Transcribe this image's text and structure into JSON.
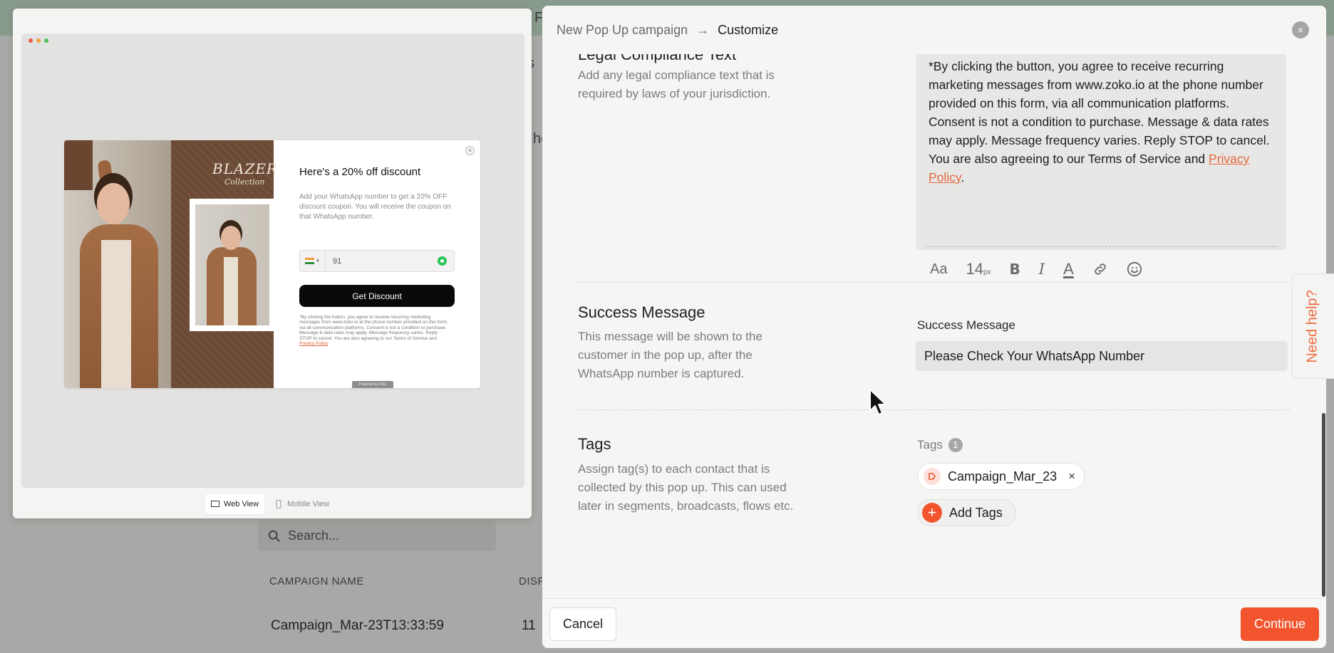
{
  "background": {
    "topbar_letter": "F",
    "partial_s": "s",
    "partial_he": "he",
    "search_placeholder": "Search...",
    "columns": [
      "CAMPAIGN NAME",
      "DISP"
    ],
    "row": {
      "name": "Campaign_Mar-23T13:33:59",
      "value": "11"
    }
  },
  "preview": {
    "popup": {
      "brand_title": "BLAZER",
      "brand_subtitle": "Collection",
      "heading": "Here's a 20% off discount",
      "description": "Add your WhatsApp number to get a 20% OFF discount coupon. You will receive the coupon on that WhatsApp number.",
      "phone_value": "91",
      "cta_label": "Get Discount",
      "legal_text": "*By clicking the button, you agree to receive recurring marketing messages from www.zoko.io at the phone number provided on this form, via all communication platforms. Consent is not a condition to purchase. Message & data rates may apply. Message frequency varies. Reply STOP to cancel. You are also agreeing to our Terms of Service and ",
      "legal_link": "Privacy Policy",
      "legal_end": ".",
      "powered_by": "Powered by Zoko"
    },
    "views": {
      "web": "Web View",
      "mobile": "Mobile View"
    }
  },
  "panel": {
    "breadcrumb": {
      "first": "New Pop Up campaign",
      "arrow": "→",
      "current": "Customize"
    },
    "legal": {
      "title": "Legal Compliance Text",
      "description": "Add any legal compliance text that is required by laws of your jurisdiction.",
      "text": "*By clicking the button, you agree to receive recurring marketing messages from www.zoko.io at the phone number provided on this form, via all communication platforms. Consent is not a condition to purchase. Message & data rates may apply. Message frequency varies. Reply STOP to cancel. You are also agreeing to our Terms of Service and ",
      "link": "Privacy Policy",
      "end": ".",
      "toolbar": {
        "font": "Aa",
        "size": "14",
        "size_unit": "px",
        "bold": "B",
        "italic": "I",
        "color": "A"
      }
    },
    "success": {
      "title": "Success Message",
      "description": "This message will be shown to the customer in the pop up, after the WhatsApp number is captured.",
      "field_label": "Success Message",
      "value": "Please Check Your WhatsApp Number"
    },
    "tags": {
      "title": "Tags",
      "description": "Assign tag(s) to each contact that is collected by this pop up. This can used later in segments, broadcasts, flows etc.",
      "label": "Tags",
      "count": "1",
      "items": [
        {
          "label": "Campaign_Mar_23"
        }
      ],
      "add_label": "Add Tags"
    },
    "footer": {
      "cancel": "Cancel",
      "continue": "Continue"
    }
  },
  "need_help": "Need help?",
  "colors": {
    "accent": "#f2542d",
    "link": "#e6693e"
  }
}
